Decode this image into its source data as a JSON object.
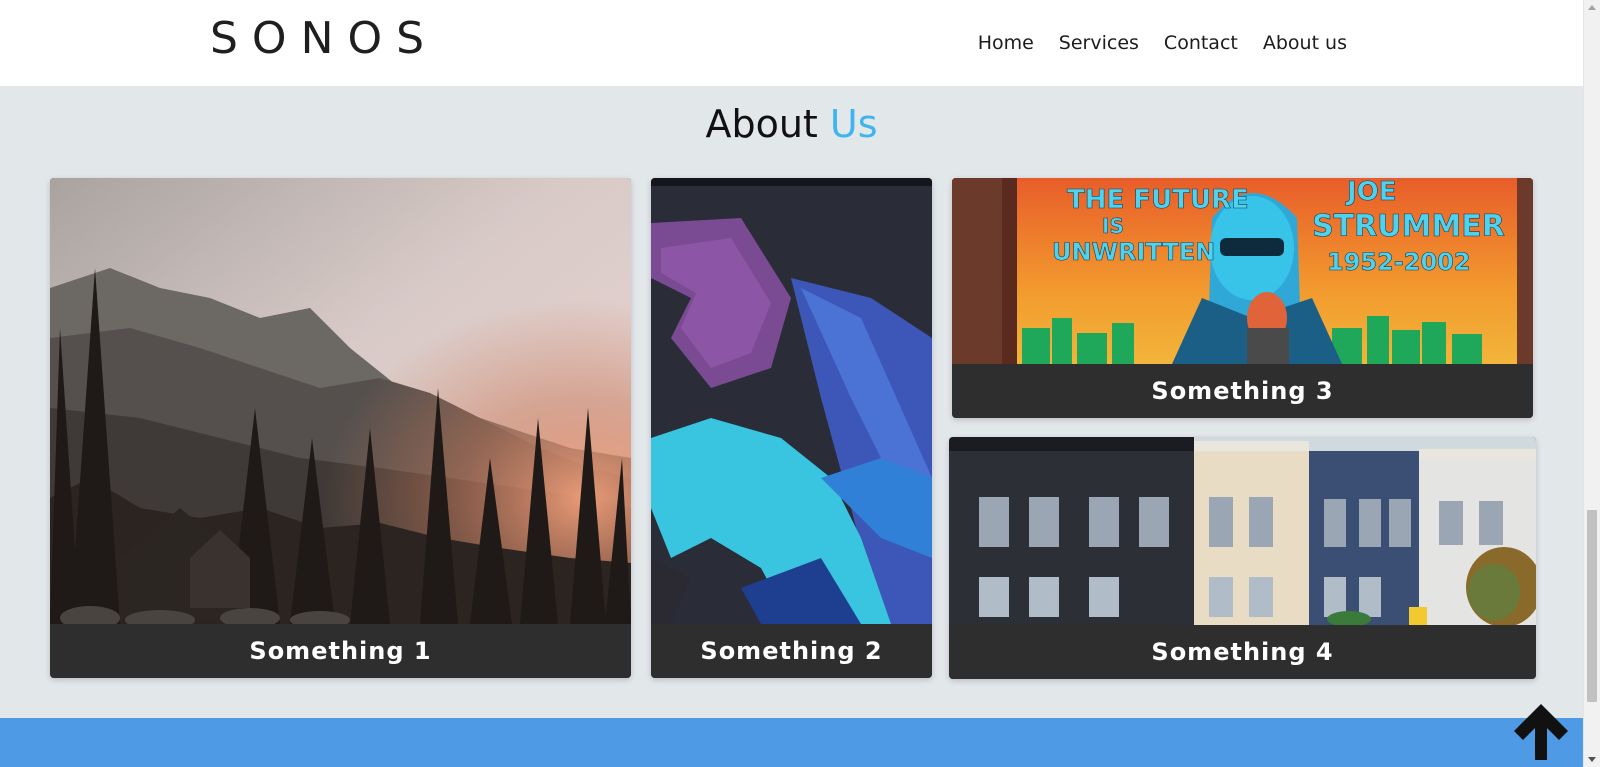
{
  "header": {
    "logo": "SONOS",
    "nav": [
      {
        "label": "Home"
      },
      {
        "label": "Services"
      },
      {
        "label": "Contact"
      },
      {
        "label": "About us"
      }
    ]
  },
  "about": {
    "title_main": "About",
    "title_accent": "Us",
    "accent_color": "#3eb5ef",
    "cards": [
      {
        "caption": "Something 1",
        "image": "misty-mountain-forest-photo"
      },
      {
        "caption": "Something 2",
        "image": "abstract-graffiti-wall-photo"
      },
      {
        "caption": "Something 3",
        "image": "joe-strummer-mural-photo",
        "mural_text": [
          "THE FUTURE",
          "IS",
          "UNWRITTEN",
          "JOE",
          "STRUMMER",
          "1952-2002"
        ]
      },
      {
        "caption": "Something 4",
        "image": "victorian-houses-photo"
      }
    ]
  },
  "footer": {
    "color": "#4e9ae4",
    "back_to_top_icon": "arrow-up-icon"
  },
  "colors": {
    "header_bg": "#ffffff",
    "page_bg": "#e2e7ea",
    "caption_bg": "#2e2e2e"
  }
}
